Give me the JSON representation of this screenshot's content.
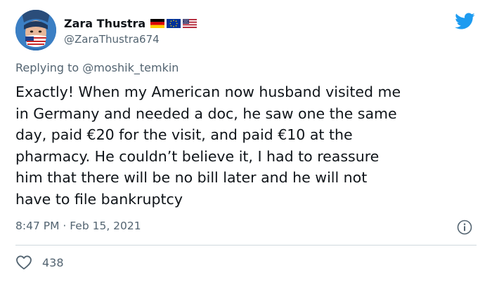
{
  "author": {
    "display_name": "Zara Thustra",
    "handle": "@ZaraThustra674",
    "name_flags": [
      "germany-flag-icon",
      "eu-flag-icon",
      "usa-flag-icon"
    ]
  },
  "brand": {
    "icon": "twitter-bird-icon",
    "color": "#1d9bf0"
  },
  "reply": {
    "prefix": "Replying to",
    "mention": "@moshik_temkin"
  },
  "tweet": {
    "lines": [
      "Exactly! When my American now husband visited me",
      "in Germany and needed a doc, he saw one the same",
      "day, paid €20 for the visit, and paid €10 at the",
      "pharmacy. He couldn’t believe it, I had to reassure",
      "him that there will be no bill later and he will not",
      "have to file bankruptcy"
    ],
    "timestamp": "8:47 PM · Feb 15, 2021"
  },
  "engagement": {
    "like_count": "438"
  },
  "colors": {
    "text": "#0f1419",
    "secondary": "#536471",
    "divider": "#cfd9de",
    "accent": "#1d9bf0"
  }
}
